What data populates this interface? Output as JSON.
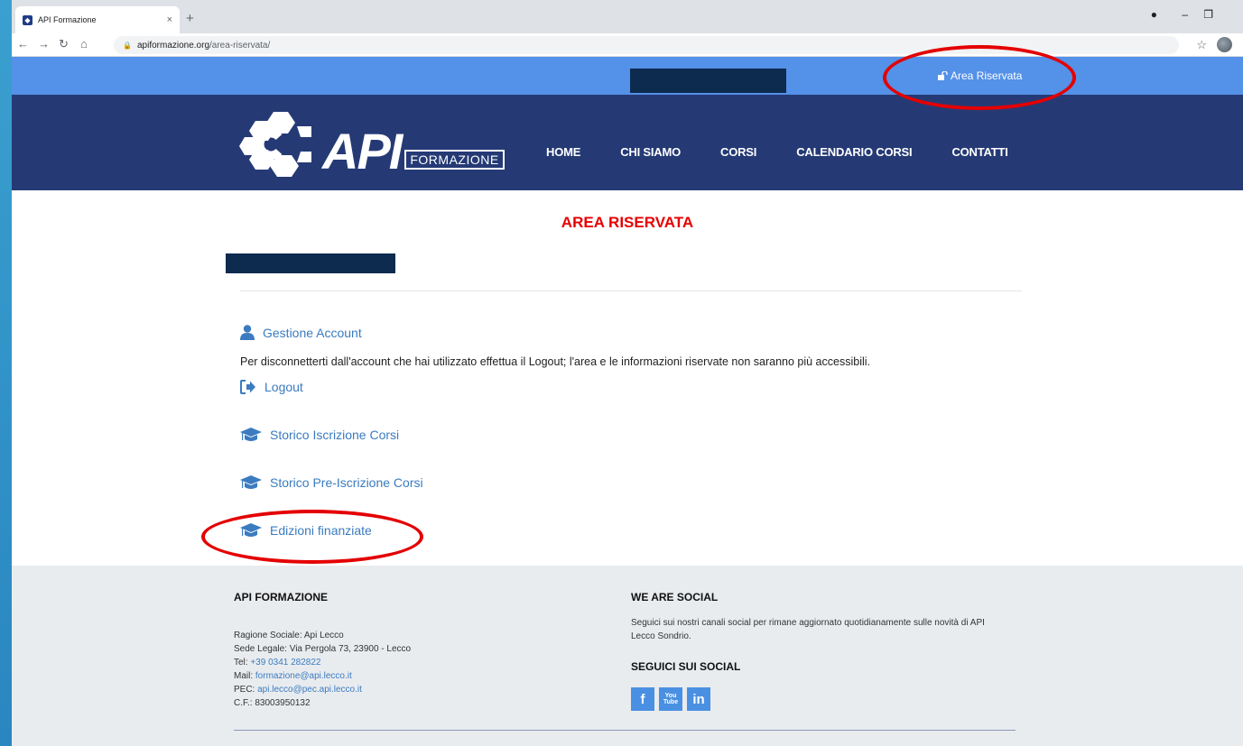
{
  "browser": {
    "tab_title": "API Formazione",
    "tab_close": "×",
    "new_tab": "+",
    "url_domain": "apiformazione.org",
    "url_path": "/area-riservata/"
  },
  "topbar": {
    "area_link_label": "Area Riservata"
  },
  "logo": {
    "api": "API",
    "formazione": "FORMAZIONE"
  },
  "nav": {
    "items": [
      "HOME",
      "CHI SIAMO",
      "CORSI",
      "CALENDARIO CORSI",
      "CONTATTI"
    ]
  },
  "main": {
    "title": "AREA RISERVATA",
    "gestione_account": "Gestione Account",
    "description": "Per disconnetterti dall'account che hai utilizzato effettua il Logout; l'area e le informazioni riservate non saranno più accessibili.",
    "logout": "Logout",
    "storico_iscrizione": "Storico Iscrizione Corsi",
    "storico_pre_iscrizione": "Storico Pre-Iscrizione Corsi",
    "edizioni_finanziate": "Edizioni finanziate"
  },
  "footer": {
    "col1_title": "API FORMAZIONE",
    "ragione_sociale": "Ragione Sociale: Api Lecco",
    "sede_legale": "Sede Legale: Via Pergola 73, 23900 - Lecco",
    "tel_label": "Tel: ",
    "tel_value": "+39 0341 282822",
    "mail_label": "Mail: ",
    "mail_value": "formazione@api.lecco.it",
    "pec_label": "PEC: ",
    "pec_value": "api.lecco@pec.api.lecco.it",
    "cf": "C.F.: 83003950132",
    "col2_title": "WE ARE SOCIAL",
    "social_text": "Seguici sui nostri canali social per rimane aggiornato quotidianamente sulle novità di API Lecco Sondrio.",
    "social_title": "SEGUICI SUI SOCIAL",
    "social": [
      "f",
      "You Tube",
      "in"
    ]
  },
  "colors": {
    "topbar": "#5491e8",
    "header": "#253a75",
    "title_red": "#e60000",
    "link_blue": "#3b7bbf",
    "annotation_red": "#e40000"
  }
}
